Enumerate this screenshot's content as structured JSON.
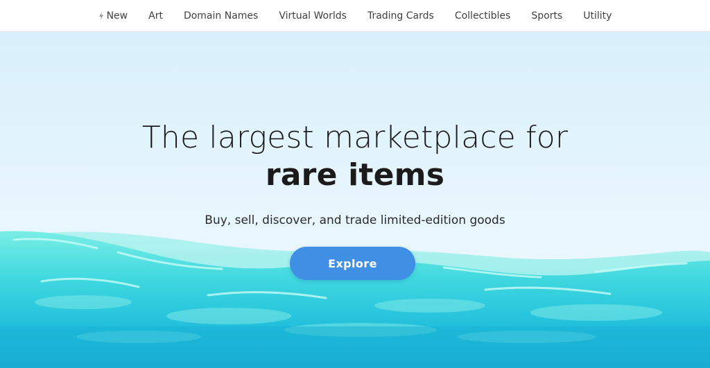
{
  "nav": {
    "items": [
      {
        "label": "New",
        "icon": "bolt-icon"
      },
      {
        "label": "Art"
      },
      {
        "label": "Domain Names"
      },
      {
        "label": "Virtual Worlds"
      },
      {
        "label": "Trading Cards"
      },
      {
        "label": "Collectibles"
      },
      {
        "label": "Sports"
      },
      {
        "label": "Utility"
      }
    ]
  },
  "hero": {
    "headline_light": "The largest marketplace for",
    "headline_bold": "rare items",
    "subtitle": "Buy, sell, discover, and trade limited-edition goods",
    "cta_label": "Explore"
  },
  "colors": {
    "cta": "#3f8fe5",
    "sky": "#e6f5fd",
    "wave_light": "#5fe3e0",
    "wave_dark": "#1fb4d8"
  }
}
